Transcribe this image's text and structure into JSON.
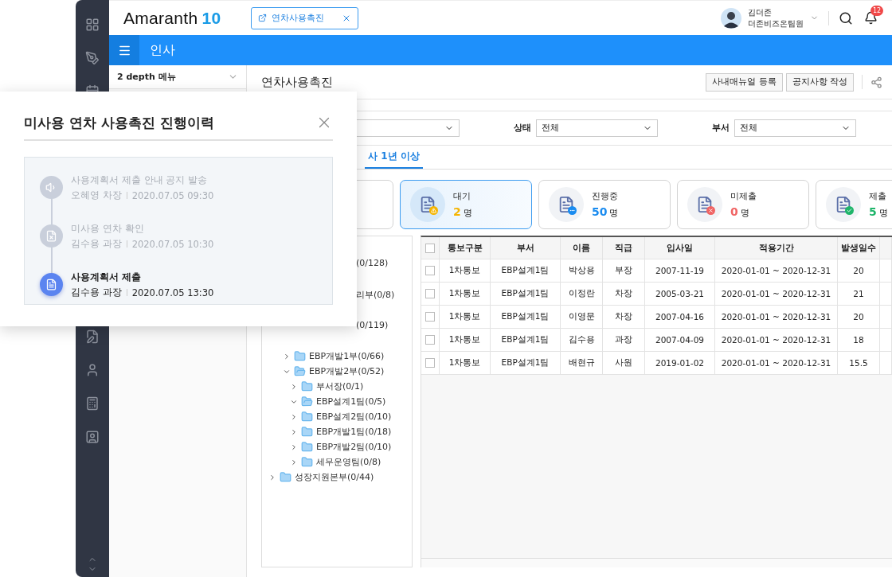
{
  "header": {
    "logo": "Amaranth",
    "logo_number": "10",
    "open_tab": "연차사용촉진",
    "user": {
      "name": "김더존",
      "team": "더존비즈온팀원"
    },
    "notification_count": "12"
  },
  "module_bar": {
    "title": "인사"
  },
  "side_menu": {
    "dropdown": "2 depth 메뉴"
  },
  "page": {
    "title": "연차사용촉진",
    "buttons": [
      "사내매뉴얼 등록",
      "공지사항 작성"
    ]
  },
  "filters": [
    {
      "label": "상태",
      "value": "전체"
    },
    {
      "label": "부서",
      "value": "전체"
    }
  ],
  "tabs": [
    {
      "label": "사 1년 이상",
      "selected": true
    }
  ],
  "status_cards": [
    {
      "label": "대기",
      "count": "2",
      "unit": "명",
      "color": "#f5b400",
      "kind": "waiting",
      "selected": true
    },
    {
      "label": "진행중",
      "count": "50",
      "unit": "명",
      "color": "#1a8cf0",
      "kind": "progress",
      "selected": false
    },
    {
      "label": "미제출",
      "count": "0",
      "unit": "명",
      "color": "#f06464",
      "kind": "missing",
      "selected": false
    },
    {
      "label": "제출",
      "count": "5",
      "unit": "명",
      "color": "#1fb56a",
      "kind": "done",
      "selected": false
    }
  ],
  "tree": [
    {
      "label": "(0/128)",
      "clipped": true,
      "children": [
        {
          "label": "리부(0/8)",
          "clipped": true
        },
        {
          "label": "(0/119)",
          "clipped": true,
          "children": [
            {
              "label": "EBP개발1부(0/66)",
              "expanded": false
            },
            {
              "label": "EBP개발2부(0/52)",
              "expanded": true,
              "children": [
                {
                  "label": "부서장(0/1)",
                  "expanded": false
                },
                {
                  "label": "EBP설계1팀(0/5)",
                  "expanded": true
                },
                {
                  "label": "EBP설계2팀(0/10)",
                  "expanded": false
                },
                {
                  "label": "EBP개발1팀(0/18)",
                  "expanded": false
                },
                {
                  "label": "EBP개발2팀(0/10)",
                  "expanded": false
                },
                {
                  "label": "세무운영팀(0/8)",
                  "expanded": false
                }
              ]
            }
          ]
        }
      ]
    },
    {
      "label": "성장지원본부(0/44)",
      "expanded": false
    }
  ],
  "table": {
    "header_checked": false,
    "columns": [
      "통보구분",
      "부서",
      "이름",
      "직급",
      "입사일",
      "적용기간",
      "발생일수"
    ],
    "rows": [
      {
        "checked": false,
        "cells": [
          "1차통보",
          "EBP설계1팀",
          "박상용",
          "부장",
          "2007-11-19",
          "2020-01-01 ~ 2020-12-31",
          "20"
        ]
      },
      {
        "checked": false,
        "cells": [
          "1차통보",
          "EBP설계1팀",
          "이정란",
          "차장",
          "2005-03-21",
          "2020-01-01 ~ 2020-12-31",
          "21"
        ]
      },
      {
        "checked": false,
        "cells": [
          "1차통보",
          "EBP설계1팀",
          "이영문",
          "차장",
          "2007-04-16",
          "2020-01-01 ~ 2020-12-31",
          "20"
        ]
      },
      {
        "checked": false,
        "cells": [
          "1차통보",
          "EBP설계1팀",
          "김수용",
          "과장",
          "2007-04-09",
          "2020-01-01 ~ 2020-12-31",
          "18"
        ]
      },
      {
        "checked": false,
        "cells": [
          "1차통보",
          "EBP설계1팀",
          "배현규",
          "사원",
          "2019-01-02",
          "2020-01-01 ~ 2020-12-31",
          "15.5"
        ]
      }
    ]
  },
  "popup": {
    "title": "미사용 연차 사용촉진 진행이력",
    "history": [
      {
        "kind": "notice",
        "title": "사용계획서 제출 안내 공지 발송",
        "person": "오혜영 차장",
        "time": "2020.07.05 09:30",
        "active": false
      },
      {
        "kind": "check",
        "title": "미사용 연차 확인",
        "person": "김수용 과장",
        "time": "2020.07.05 10:30",
        "active": false
      },
      {
        "kind": "submit",
        "title": "사용계획서 제출",
        "person": "김수용 과장",
        "time": "2020.07.05 13:30",
        "active": true
      }
    ]
  }
}
